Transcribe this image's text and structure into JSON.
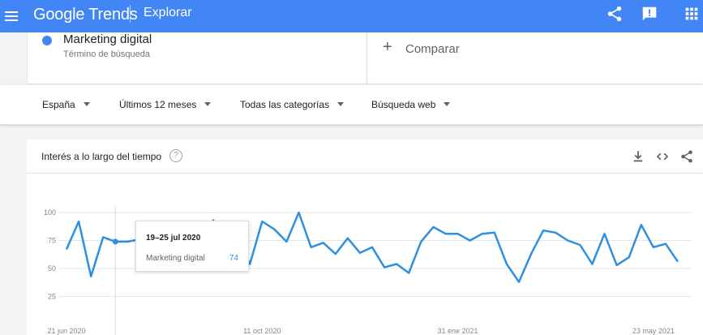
{
  "header": {
    "logo_text": "Google Trends",
    "section": "Explorar",
    "icons": [
      "menu-icon",
      "share-icon",
      "feedback-icon",
      "apps-icon"
    ]
  },
  "search": {
    "term": "Marketing digital",
    "term_type": "Término de búsqueda",
    "compare_label": "Comparar"
  },
  "filters": {
    "region": "España",
    "period": "Últimos 12 meses",
    "category": "Todas las categorías",
    "search_type": "Búsqueda web"
  },
  "interest_card": {
    "title": "Interés a lo largo del tiempo",
    "help_symbol": "?",
    "icons": [
      "download-icon",
      "embed-icon",
      "share-icon"
    ]
  },
  "tooltip": {
    "date": "19–25 jul 2020",
    "term": "Marketing digital",
    "value": "74"
  },
  "colors": {
    "brand_blue": "#4285f4",
    "series_line": "#2f8fe0"
  },
  "chart_data": {
    "type": "line",
    "title": "",
    "xlabel": "",
    "ylabel": "",
    "ylim": [
      0,
      100
    ],
    "yticks": [
      "100",
      "75",
      "50",
      "25"
    ],
    "xticks": [
      {
        "label": "21 jun 2020",
        "index": 0
      },
      {
        "label": "11 oct 2020",
        "index": 16
      },
      {
        "label": "31 ene 2021",
        "index": 32
      },
      {
        "label": "23 may 2021",
        "index": 48
      }
    ],
    "grid": true,
    "series": [
      {
        "name": "Marketing digital",
        "values": [
          67,
          92,
          43,
          78,
          74,
          74,
          76,
          75,
          77,
          75,
          89,
          75,
          93,
          78,
          76,
          54,
          92,
          85,
          74,
          100,
          69,
          73,
          63,
          77,
          64,
          69,
          51,
          54,
          46,
          74,
          87,
          81,
          81,
          75,
          81,
          82,
          54,
          38,
          63,
          84,
          82,
          75,
          71,
          54,
          81,
          53,
          60,
          89,
          69,
          72,
          56
        ]
      }
    ]
  }
}
